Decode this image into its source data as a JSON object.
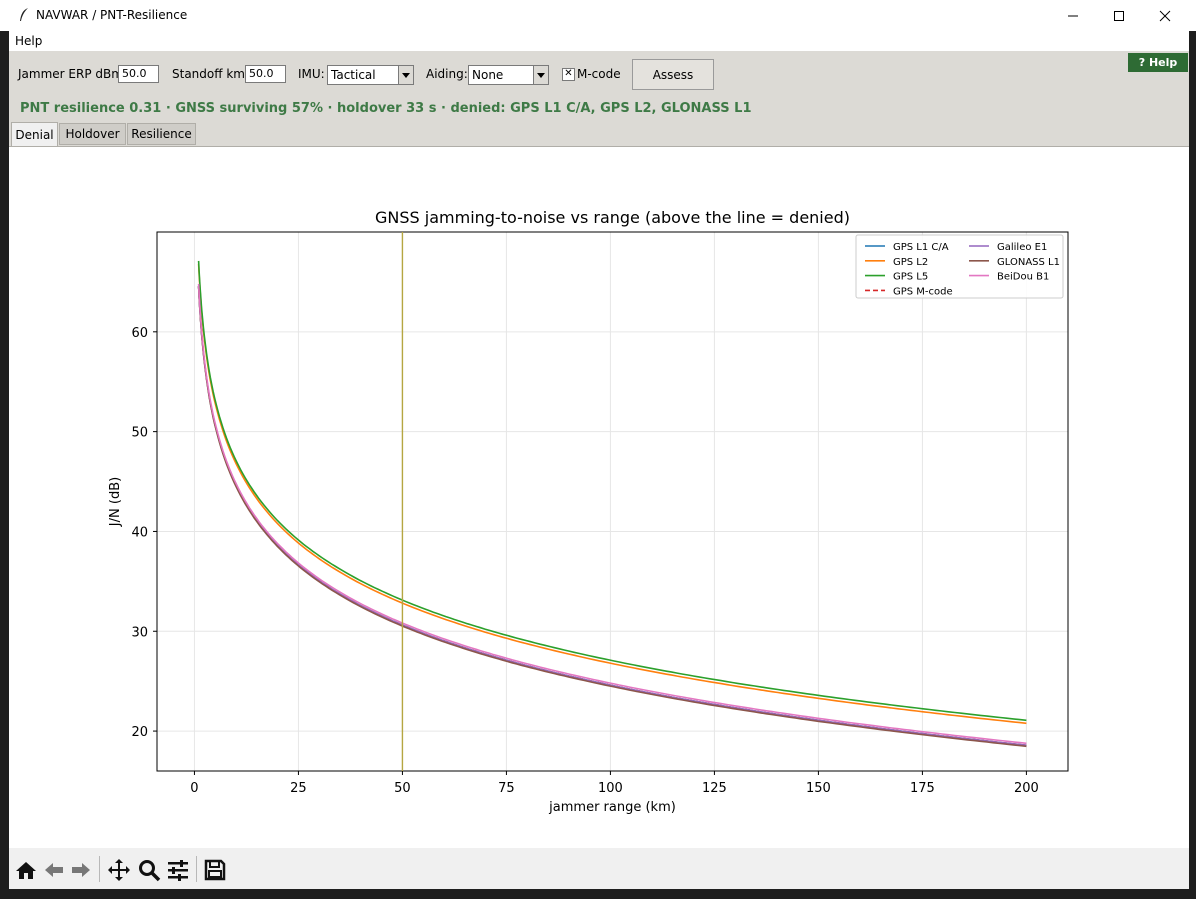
{
  "window": {
    "title": "NAVWAR / PNT-Resilience"
  },
  "menu": {
    "help": "Help"
  },
  "controls": {
    "jammer_label": "Jammer ERP dBm:",
    "jammer_value": "50.0",
    "standoff_label": "Standoff km:",
    "standoff_value": "50.0",
    "imu_label": "IMU:",
    "imu_value": "Tactical",
    "aiding_label": "Aiding:",
    "aiding_value": "None",
    "mcode_label": "M-code",
    "mcode_checked": true,
    "assess_label": "Assess",
    "help_label": "? Help"
  },
  "status": "PNT resilience 0.31  ·  GNSS surviving 57%  ·  holdover 33 s  ·  denied: GPS L1 C/A, GPS L2, GLONASS L1",
  "tabs": [
    {
      "label": "Denial",
      "active": true
    },
    {
      "label": "Holdover",
      "active": false
    },
    {
      "label": "Resilience",
      "active": false
    }
  ],
  "toolbar": {
    "icons": [
      "home-icon",
      "back-icon",
      "forward-icon",
      "pan-icon",
      "zoom-icon",
      "configure-icon",
      "save-icon"
    ]
  },
  "chart_data": {
    "type": "line",
    "title": "GNSS jamming-to-noise vs range (above the line = denied)",
    "xlabel": "jammer range (km)",
    "ylabel": "J/N (dB)",
    "xlim": [
      -9,
      210
    ],
    "ylim": [
      16,
      70
    ],
    "xticks": [
      0,
      25,
      50,
      75,
      100,
      125,
      150,
      175,
      200
    ],
    "yticks": [
      20,
      30,
      40,
      50,
      60
    ],
    "grid": true,
    "legend_position": "top-right",
    "x_start": 1,
    "x_end": 200,
    "series": [
      {
        "name": "GPS L1 C/A",
        "color": "#1f77b4",
        "dash": false,
        "jn_at_1km": 64.6
      },
      {
        "name": "GPS L2",
        "color": "#ff7f0e",
        "dash": false,
        "jn_at_1km": 66.8
      },
      {
        "name": "GPS L5",
        "color": "#2ca02c",
        "dash": false,
        "jn_at_1km": 67.1
      },
      {
        "name": "GPS M-code",
        "color": "#d62728",
        "dash": true,
        "jn_at_1km": 64.6
      },
      {
        "name": "Galileo E1",
        "color": "#9467bd",
        "dash": false,
        "jn_at_1km": 64.6
      },
      {
        "name": "GLONASS L1",
        "color": "#8c564b",
        "dash": false,
        "jn_at_1km": 64.5
      },
      {
        "name": "BeiDou B1",
        "color": "#e377c2",
        "dash": false,
        "jn_at_1km": 64.8
      }
    ],
    "vline": {
      "x": 50,
      "color": "#b5a642"
    }
  }
}
